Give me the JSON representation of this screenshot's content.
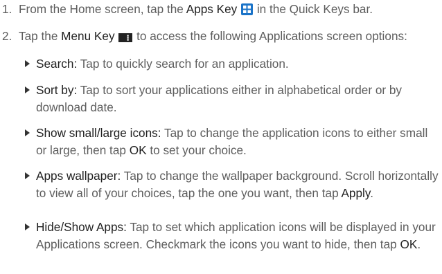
{
  "steps": [
    {
      "num": "1.",
      "pre": "From the Home screen, tap the ",
      "key": "Apps Key",
      "post": " in the Quick Keys bar.",
      "icon": "apps-key-icon"
    },
    {
      "num": "2.",
      "pre": "Tap the ",
      "key": "Menu Key",
      "post": " to access the following Applications screen options:",
      "icon": "menu-key-icon"
    }
  ],
  "options": [
    {
      "term": "Search:",
      "desc": "Tap to quickly search for an application."
    },
    {
      "term": "Sort by:",
      "desc": "Tap to sort your applications either in alphabetical order or by download date."
    },
    {
      "term": "Show small/large icons:",
      "desc_pre": "Tap to change the application icons to either small or large, then tap ",
      "kw": "OK",
      "desc_post": " to set your choice."
    },
    {
      "term": "Apps wallpaper:",
      "desc_pre": "Tap to change the wallpaper background. Scroll horizontally to view all of your choices, tap the one you want, then tap ",
      "kw": "Apply",
      "desc_post": "."
    },
    {
      "term": "Hide/Show Apps:",
      "desc_pre": "Tap to set which application icons will be displayed in your Applications screen. Checkmark the icons you want to hide, then tap ",
      "kw": "OK",
      "desc_post": "."
    }
  ],
  "colors": {
    "body_text": "#5d5d5d",
    "keyword_text": "#222222",
    "apps_icon": "#1a73c8",
    "menu_icon": "#222222"
  }
}
